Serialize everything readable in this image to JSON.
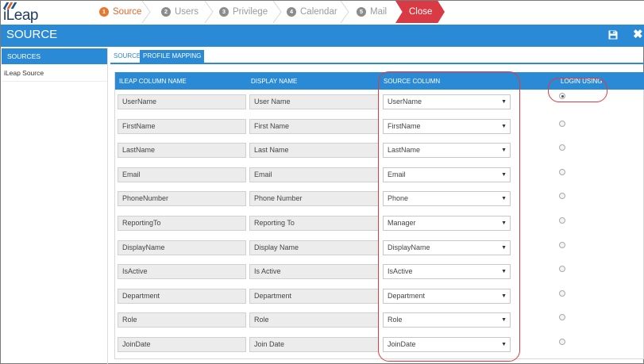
{
  "app": {
    "logo_text": "iLeap",
    "page_title": "SOURCE"
  },
  "wizard": {
    "steps": [
      {
        "num": "1",
        "label": "Source",
        "active": true
      },
      {
        "num": "2",
        "label": "Users",
        "active": false
      },
      {
        "num": "3",
        "label": "Privilege",
        "active": false
      },
      {
        "num": "4",
        "label": "Calendar",
        "active": false
      },
      {
        "num": "5",
        "label": "Mail",
        "active": false
      }
    ],
    "close_label": "Close"
  },
  "header": {
    "save_icon": "floppy-disk-icon",
    "close_icon": "close-icon",
    "close_glyph": "✖"
  },
  "sidebar": {
    "title": "SOURCES",
    "items": [
      "iLeap Source"
    ]
  },
  "tabs": {
    "source": "SOURCE",
    "profile_mapping": "PROFILE MAPPING",
    "active": "PROFILE MAPPING"
  },
  "table": {
    "headers": {
      "ileap_column": "ILEAP COLUMN NAME",
      "display_name": "DISPLAY NAME",
      "source_column": "SOURCE COLUMN",
      "login_using": "LOGIN USING"
    },
    "rows": [
      {
        "ileap": "UserName",
        "display": "User Name",
        "source": "UserName",
        "login": true
      },
      {
        "ileap": "FirstName",
        "display": "First Name",
        "source": "FirstName",
        "login": false
      },
      {
        "ileap": "LastName",
        "display": "Last Name",
        "source": "LastName",
        "login": false
      },
      {
        "ileap": "Email",
        "display": "Email",
        "source": "Email",
        "login": false
      },
      {
        "ileap": "PhoneNumber",
        "display": "Phone Number",
        "source": "Phone",
        "login": false
      },
      {
        "ileap": "ReportingTo",
        "display": "Reporting To",
        "source": "Manager",
        "login": false
      },
      {
        "ileap": "DisplayName",
        "display": "Display Name",
        "source": "DisplayName",
        "login": false
      },
      {
        "ileap": "IsActive",
        "display": "Is Active",
        "source": "IsActive",
        "login": false
      },
      {
        "ileap": "Department",
        "display": "Department",
        "source": "Department",
        "login": false
      },
      {
        "ileap": "Role",
        "display": "Role",
        "source": "Role",
        "login": false
      },
      {
        "ileap": "JoinDate",
        "display": "Join Date",
        "source": "JoinDate",
        "login": false
      }
    ]
  },
  "colors": {
    "accent": "#2a8ad5",
    "close_button": "#d93a44",
    "active_step": "#e8762f",
    "annotation": "#e23a3a"
  }
}
